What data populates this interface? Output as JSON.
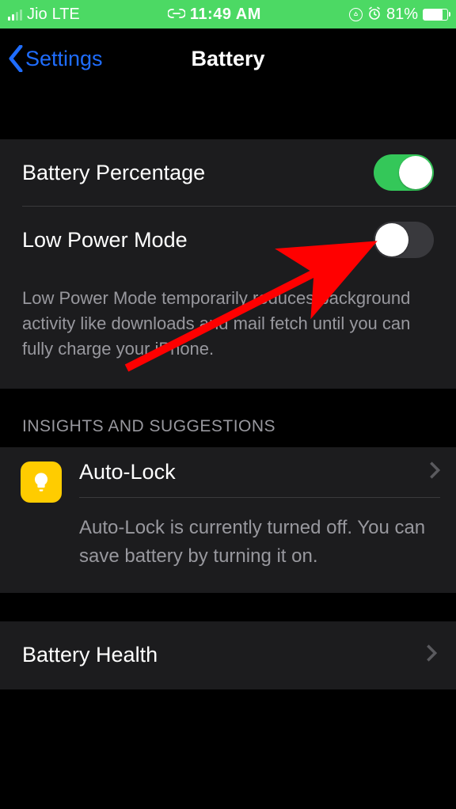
{
  "status": {
    "carrier": "Jio",
    "network": "LTE",
    "time": "11:49 AM",
    "battery_percent": "81%"
  },
  "nav": {
    "back_label": "Settings",
    "title": "Battery"
  },
  "rows": {
    "battery_percentage_label": "Battery Percentage",
    "low_power_mode_label": "Low Power Mode",
    "low_power_mode_footer": "Low Power Mode temporarily reduces background activity like downloads and mail fetch until you can fully charge your iPhone.",
    "battery_health_label": "Battery Health"
  },
  "insights": {
    "header": "INSIGHTS AND SUGGESTIONS",
    "autolock_title": "Auto-Lock",
    "autolock_desc": "Auto-Lock is currently turned off. You can save battery by turning it on."
  }
}
